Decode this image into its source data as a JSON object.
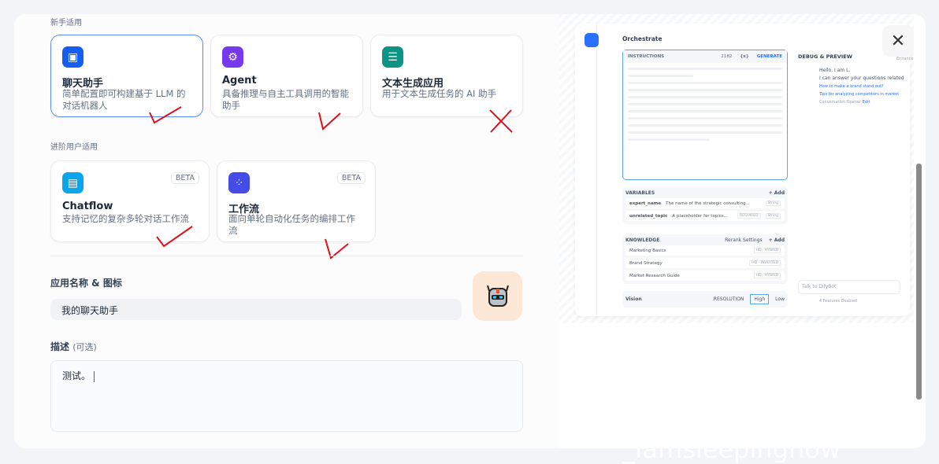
{
  "sections": {
    "beginner": "新手适用",
    "advanced": "进阶用户适用"
  },
  "app_types": [
    {
      "title": "聊天助手",
      "desc": "简单配置即可构建基于 LLM 的对话机器人",
      "color": "#155eef",
      "icon": "chat-bot-icon",
      "selected": true
    },
    {
      "title": "Agent",
      "desc": "具备推理与自主工具调用的智能助手",
      "color": "#7839ee",
      "icon": "agent-head-icon"
    },
    {
      "title": "文本生成应用",
      "desc": "用于文本生成任务的 AI 助手",
      "color": "#0e9384",
      "icon": "text-generation-icon"
    },
    {
      "title": "Chatflow",
      "desc": "支持记忆的复杂多轮对话工作流",
      "color": "#0ba5ec",
      "icon": "chatflow-icon",
      "badge": "BETA"
    },
    {
      "title": "工作流",
      "desc": "面向单轮自动化任务的编排工作流",
      "color": "#444ce7",
      "icon": "workflow-icon",
      "badge": "BETA"
    }
  ],
  "form": {
    "name_label": "应用名称 & 图标",
    "name_value": "我的聊天助手",
    "desc_label": "描述",
    "desc_optional": "(可选)",
    "desc_value": "测试。"
  },
  "preview": {
    "title": "Orchestrate",
    "instructions": "INSTRUCTIONS",
    "count": "2182",
    "var_btn": "{x}",
    "generate": "GENERATE",
    "variables_title": "VARIABLES",
    "add": "+ Add",
    "variables": [
      {
        "name": "expert_name",
        "desc": "The name of the strategic consulting...",
        "type": "String"
      },
      {
        "name": "unrelated_topic",
        "desc": "A placeholder for topics...",
        "required": "REQUIRED",
        "type": "String"
      }
    ],
    "knowledge_title": "KNOWLEDGE",
    "rerank": "Rerank Settings",
    "knowledge": [
      {
        "name": "Marketing Basics",
        "tag": "HQ · HYBRID"
      },
      {
        "name": "Brand Strategy",
        "tag": "HQ · INVERTED"
      },
      {
        "name": "Market Research Guide",
        "tag": "HQ · HYBRID"
      }
    ],
    "vision": "Vision",
    "resolution": "RESOLUTION",
    "high": "High",
    "low": "Low",
    "debug_title": "DEBUG & PREVIEW",
    "greeting1": "Hello, I am L.",
    "greeting2": "I can answer your questions related",
    "suggestion1": "How to make a brand stand out?",
    "suggestion2": "Tips for analyzing competitors in market",
    "opener": "Conversation Opener",
    "edit": "Edit",
    "talk_placeholder": "Talk to DifyBot",
    "features": "4 Features Enabled",
    "enhance": "Enhance"
  },
  "watermark": "_Iamsleepingnow",
  "annotation_color": "#e0101a"
}
